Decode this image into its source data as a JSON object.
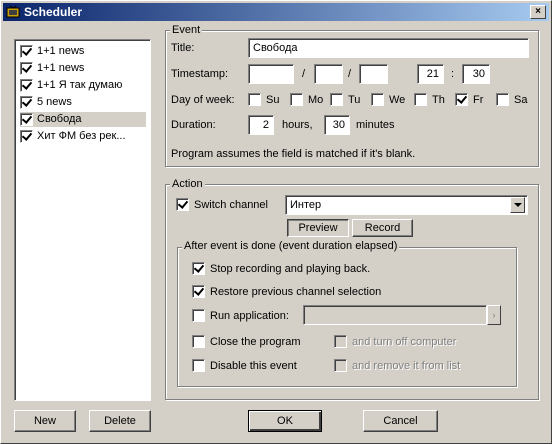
{
  "window": {
    "title": "Scheduler",
    "close_glyph": "×"
  },
  "list": {
    "items": [
      {
        "label": "1+1 news",
        "checked": true
      },
      {
        "label": "1+1 news",
        "checked": true
      },
      {
        "label": "1+1 Я так думаю",
        "checked": true
      },
      {
        "label": "5 news",
        "checked": true
      },
      {
        "label": "Свобода",
        "checked": true,
        "selected": true
      },
      {
        "label": "Хит ФМ без рек...",
        "checked": true
      }
    ]
  },
  "event": {
    "group_label": "Event",
    "title_label": "Title:",
    "title_value": "Свобода",
    "timestamp_label": "Timestamp:",
    "date_sep": "/",
    "time_sep": ":",
    "date_day": "",
    "date_month": "",
    "date_year": "",
    "time_hour": "21",
    "time_minute": "30",
    "dow_label": "Day of week:",
    "days": [
      {
        "label": "Su",
        "checked": false
      },
      {
        "label": "Mo",
        "checked": false
      },
      {
        "label": "Tu",
        "checked": false
      },
      {
        "label": "We",
        "checked": false
      },
      {
        "label": "Th",
        "checked": false
      },
      {
        "label": "Fr",
        "checked": true
      },
      {
        "label": "Sa",
        "checked": false
      }
    ],
    "duration_label": "Duration:",
    "duration_hours": "2",
    "hours_label": "hours,",
    "duration_minutes": "30",
    "minutes_label": "minutes",
    "note": "Program assumes the field is matched if it's blank."
  },
  "action": {
    "group_label": "Action",
    "switch_channel_label": "Switch channel",
    "switch_channel_checked": true,
    "channel_value": "Интер",
    "preview_label": "Preview",
    "record_label": "Record",
    "after_group_label": "After event is done (event duration elapsed)",
    "stop_label": "Stop recording and playing back.",
    "stop_checked": true,
    "restore_label": "Restore previous channel selection",
    "restore_checked": true,
    "run_app_label": "Run application:",
    "run_app_checked": false,
    "run_app_value": "",
    "browse_glyph": "›",
    "close_program_label": "Close the program",
    "close_program_checked": false,
    "turn_off_label": "and turn off computer",
    "disable_label": "Disable this event",
    "disable_checked": false,
    "remove_label": "and remove it from list"
  },
  "buttons": {
    "new": "New",
    "delete": "Delete",
    "ok": "OK",
    "cancel": "Cancel"
  }
}
